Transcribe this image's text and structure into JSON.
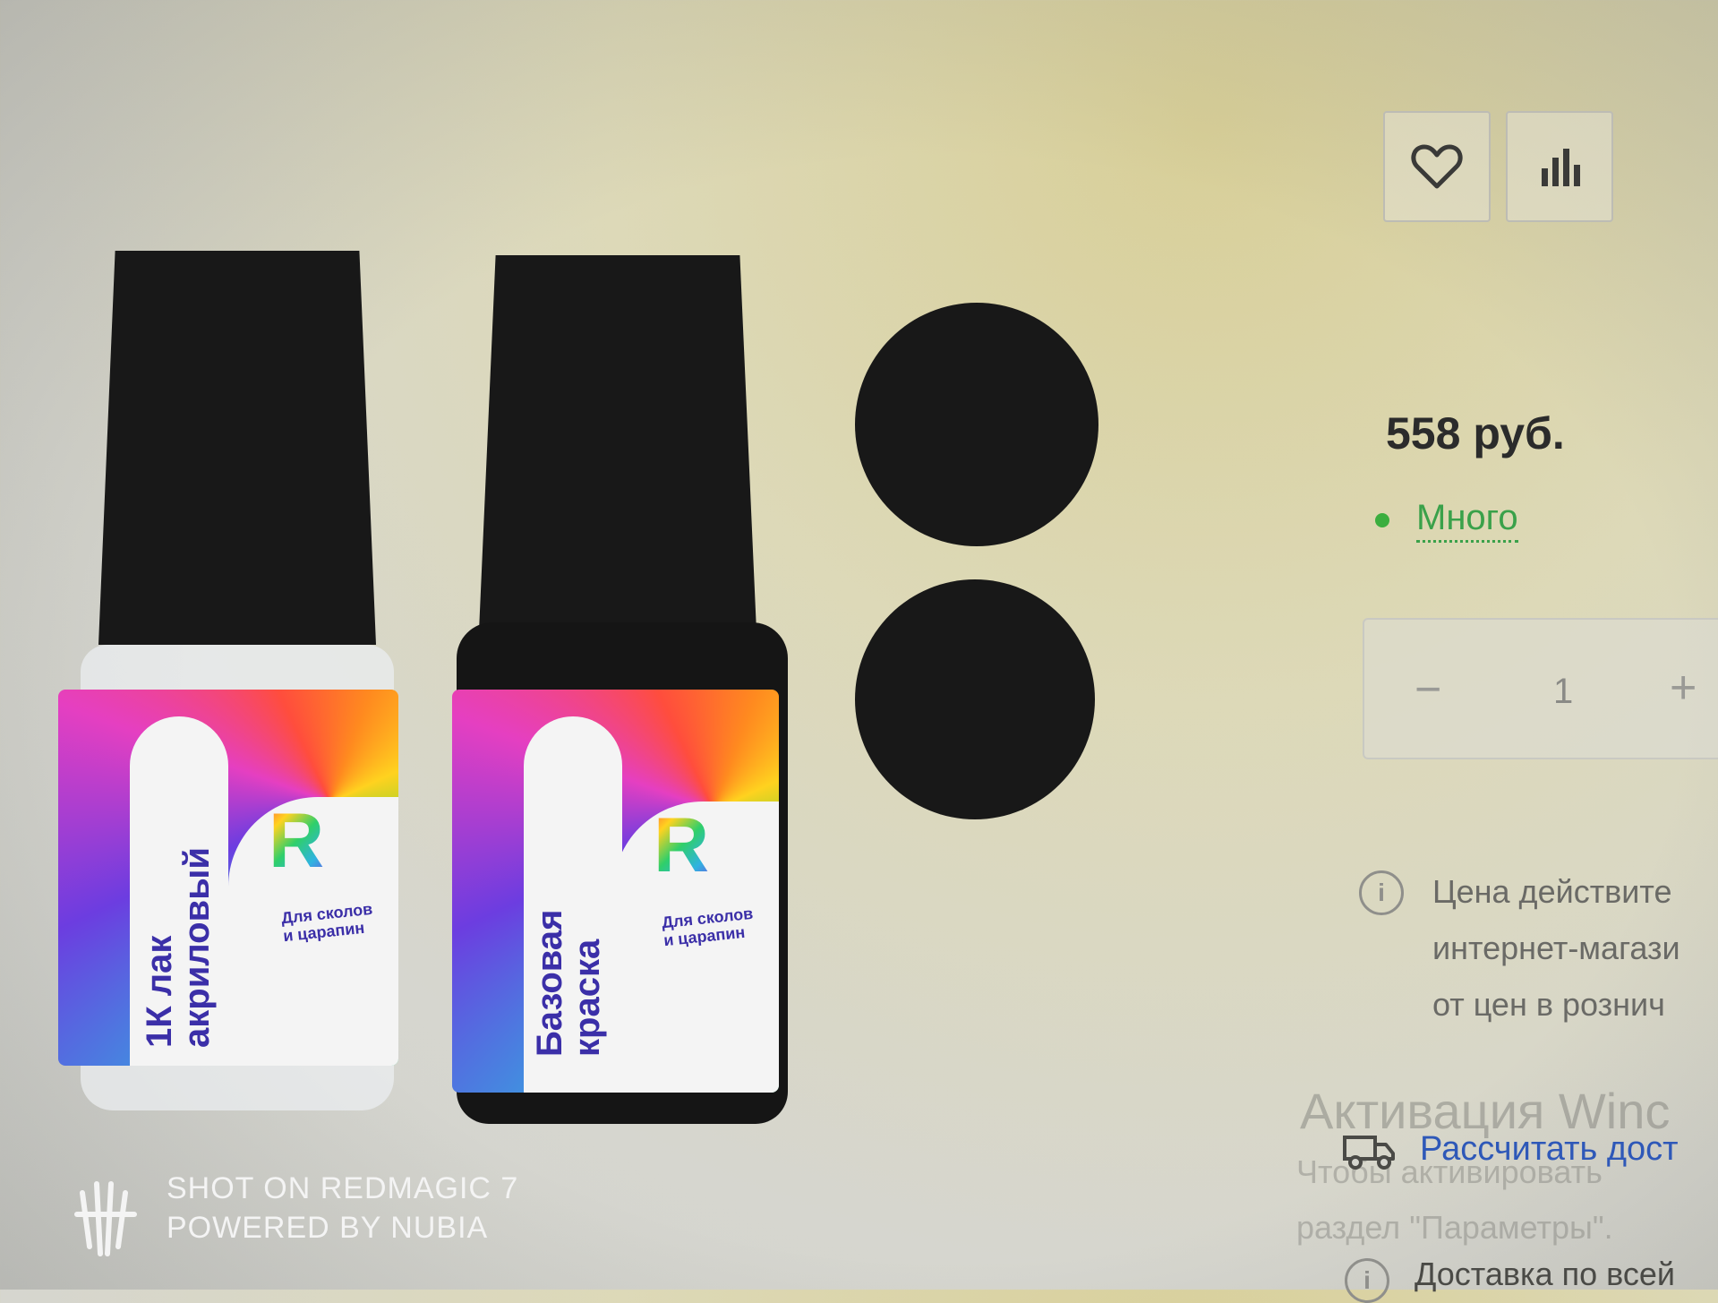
{
  "actions": {
    "favorite_icon": "heart-icon",
    "compare_icon": "bar-chart-icon"
  },
  "products": {
    "bottle1_label": "1К лак акриловый",
    "bottle1_line1": "1К лак",
    "bottle1_line2": "акриловый",
    "bottle2_label": "Базовая краска",
    "bottle2_line1": "Базовая",
    "bottle2_line2": "краска",
    "tagline_line1": "Для сколов",
    "tagline_line2": "и царапин",
    "logo_letter": "R"
  },
  "colors": {
    "swatch": "#181818",
    "accent_text": "#3b2fa8",
    "stock_green": "#3aa14a",
    "link_blue": "#2e58b8"
  },
  "purchase": {
    "price": "558 руб.",
    "stock": "Много",
    "qty_minus": "−",
    "qty_value": "1",
    "qty_plus": "+"
  },
  "info": {
    "line1": "Цена действите",
    "line2": "интернет-магази",
    "line3": "от цен в рознич"
  },
  "watermark": {
    "title": "Активация Winc",
    "line1": "Чтобы активировать",
    "line2": "раздел \"Параметры\"."
  },
  "delivery": {
    "calc_link": "Рассчитать дост",
    "all_regions": "Доставка по всей"
  },
  "camera_watermark": {
    "line1": "SHOT ON REDMAGIC 7",
    "line2": "POWERED BY NUBIA"
  }
}
